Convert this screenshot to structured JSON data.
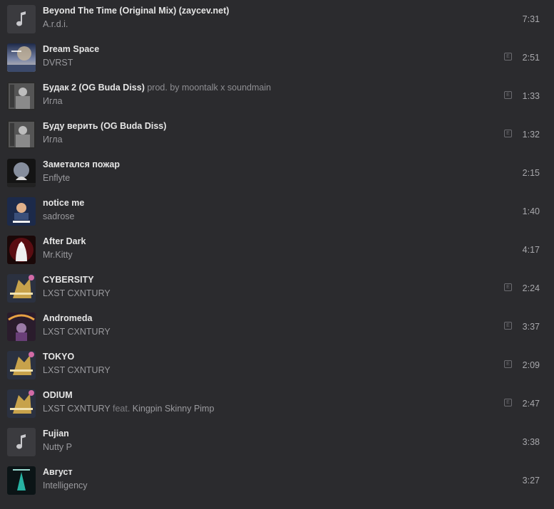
{
  "tracks": [
    {
      "title": "Beyond The Time (Original Mix) (zaycev.net)",
      "subtitle": "",
      "artist": "A.r.d.i.",
      "feat_prefix": "",
      "feat_artist": "",
      "duration": "7:31",
      "explicit": false,
      "cover": "music-note-icon"
    },
    {
      "title": "Dream Space",
      "subtitle": "",
      "artist": "DVRST",
      "feat_prefix": "",
      "feat_artist": "",
      "duration": "2:51",
      "explicit": true,
      "cover": "album-cover"
    },
    {
      "title": "Будак 2 (OG Buda Diss)",
      "subtitle": "prod. by moontalk x soundmain",
      "artist": "Игла",
      "feat_prefix": "",
      "feat_artist": "",
      "duration": "1:33",
      "explicit": true,
      "cover": "album-cover"
    },
    {
      "title": "Буду верить (OG Buda Diss)",
      "subtitle": "",
      "artist": "Игла",
      "feat_prefix": "",
      "feat_artist": "",
      "duration": "1:32",
      "explicit": true,
      "cover": "album-cover"
    },
    {
      "title": "Заметался пожар",
      "subtitle": "",
      "artist": "Enflyte",
      "feat_prefix": "",
      "feat_artist": "",
      "duration": "2:15",
      "explicit": false,
      "cover": "album-cover"
    },
    {
      "title": "notice me",
      "subtitle": "",
      "artist": "sadrose",
      "feat_prefix": "",
      "feat_artist": "",
      "duration": "1:40",
      "explicit": false,
      "cover": "album-cover"
    },
    {
      "title": "After Dark",
      "subtitle": "",
      "artist": "Mr.Kitty",
      "feat_prefix": "",
      "feat_artist": "",
      "duration": "4:17",
      "explicit": false,
      "cover": "album-cover"
    },
    {
      "title": "CYBERSITY",
      "subtitle": "",
      "artist": "LXST CXNTURY",
      "feat_prefix": "",
      "feat_artist": "",
      "duration": "2:24",
      "explicit": true,
      "cover": "album-cover"
    },
    {
      "title": "Andromeda",
      "subtitle": "",
      "artist": "LXST CXNTURY",
      "feat_prefix": "",
      "feat_artist": "",
      "duration": "3:37",
      "explicit": true,
      "cover": "album-cover"
    },
    {
      "title": "TOKYO",
      "subtitle": "",
      "artist": "LXST CXNTURY",
      "feat_prefix": "",
      "feat_artist": "",
      "duration": "2:09",
      "explicit": true,
      "cover": "album-cover"
    },
    {
      "title": "ODIUM",
      "subtitle": "",
      "artist": "LXST CXNTURY",
      "feat_prefix": "feat.",
      "feat_artist": "Kingpin Skinny Pimp",
      "duration": "2:47",
      "explicit": true,
      "cover": "album-cover"
    },
    {
      "title": "Fujian",
      "subtitle": "",
      "artist": "Nutty P",
      "feat_prefix": "",
      "feat_artist": "",
      "duration": "3:38",
      "explicit": false,
      "cover": "music-note-icon"
    },
    {
      "title": "Август",
      "subtitle": "",
      "artist": "Intelligency",
      "feat_prefix": "",
      "feat_artist": "",
      "duration": "3:27",
      "explicit": false,
      "cover": "album-cover"
    }
  ],
  "explicit_mark": "E",
  "colors": {
    "background": "#2b2b2e",
    "title": "#e6e6e6",
    "artist": "#9a9a9e",
    "duration": "#a8a8ac"
  }
}
